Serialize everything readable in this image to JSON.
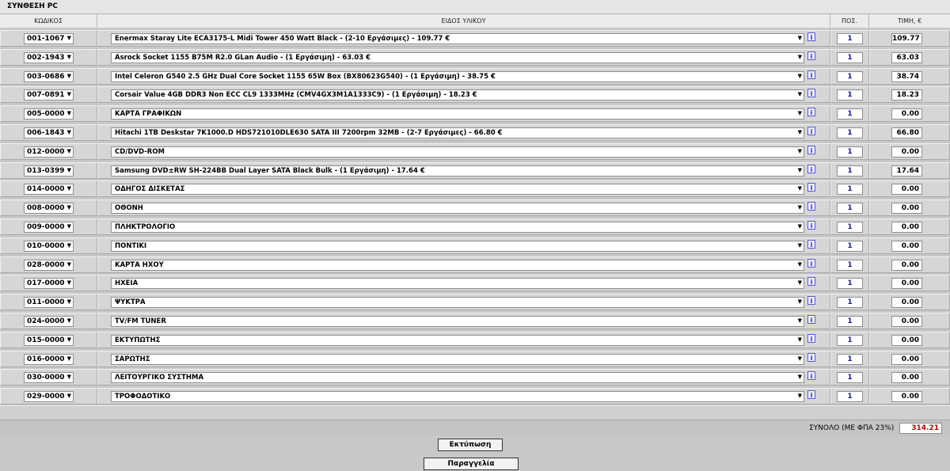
{
  "title": "ΣΥΝΘΕΣΗ PC",
  "headers": {
    "code": "ΚΩΔΙΚΟΣ",
    "item": "ΕΙΔΟΣ ΥΛΙΚΟΥ",
    "qty": "ΠΟΣ.",
    "price": "ΤΙΜΗ, €"
  },
  "rows": [
    {
      "code": "001-1067",
      "item": "Enermax Staray Lite ECA3175-L Midi Tower 450 Watt Black - (2-10 Εργάσιμες) - 109.77 €",
      "qty": "1",
      "price": "109.77"
    },
    {
      "code": "002-1943",
      "item": "Asrock Socket 1155 B75M R2.0 GLan Audio - (1 Εργάσιμη) - 63.03 €",
      "qty": "1",
      "price": "63.03"
    },
    {
      "code": "003-0686",
      "item": "Intel Celeron G540 2.5 GHz Dual Core Socket 1155 65W Box (BX80623G540) - (1 Εργάσιμη) - 38.75 €",
      "qty": "1",
      "price": "38.74"
    },
    {
      "code": "007-0891",
      "item": "Corsair Value 4GB DDR3 Non ECC CL9 1333MHz (CMV4GX3M1A1333C9) - (1 Εργάσιμη) - 18.23 €",
      "qty": "1",
      "price": "18.23"
    },
    {
      "code": "005-0000",
      "item": "ΚΑΡΤΑ ΓΡΑΦΙΚΩΝ",
      "qty": "1",
      "price": "0.00"
    },
    {
      "code": "006-1843",
      "item": "Hitachi 1TB Deskstar 7K1000.D HDS721010DLE630 SATA III 7200rpm 32MB - (2-7 Εργάσιμες) - 66.80 €",
      "qty": "1",
      "price": "66.80"
    },
    {
      "code": "012-0000",
      "item": "CD/DVD-ROM",
      "qty": "1",
      "price": "0.00"
    },
    {
      "code": "013-0399",
      "item": "Samsung DVD±RW SH-224BB Dual Layer SATA Black Bulk - (1 Εργάσιμη) - 17.64 €",
      "qty": "1",
      "price": "17.64"
    },
    {
      "code": "014-0000",
      "item": "ΟΔΗΓΟΣ ΔΙΣΚΕΤΑΣ",
      "qty": "1",
      "price": "0.00"
    },
    {
      "code": "008-0000",
      "item": "ΟΘΟΝΗ",
      "qty": "1",
      "price": "0.00"
    },
    {
      "code": "009-0000",
      "item": "ΠΛΗΚΤΡΟΛΟΓΙΟ",
      "qty": "1",
      "price": "0.00"
    },
    {
      "code": "010-0000",
      "item": "ΠΟΝΤΙΚΙ",
      "qty": "1",
      "price": "0.00"
    },
    {
      "code": "028-0000",
      "item": "ΚΑΡΤΑ ΗΧΟΥ",
      "qty": "1",
      "price": "0.00"
    },
    {
      "code": "017-0000",
      "item": "ΗΧΕΙΑ",
      "qty": "1",
      "price": "0.00"
    },
    {
      "code": "011-0000",
      "item": "ΨΥΚΤΡΑ",
      "qty": "1",
      "price": "0.00"
    },
    {
      "code": "024-0000",
      "item": "TV/FM TUNER",
      "qty": "1",
      "price": "0.00"
    },
    {
      "code": "015-0000",
      "item": "ΕΚΤΥΠΩΤΗΣ",
      "qty": "1",
      "price": "0.00"
    },
    {
      "code": "016-0000",
      "item": "ΣΑΡΩΤΗΣ",
      "qty": "1",
      "price": "0.00"
    },
    {
      "code": "030-0000",
      "item": "ΛΕΙΤΟΥΡΓΙΚΟ ΣΥΣΤΗΜΑ",
      "qty": "1",
      "price": "0.00"
    },
    {
      "code": "029-0000",
      "item": "ΤΡΟΦΟΔΟΤΙΚΟ",
      "qty": "1",
      "price": "0.00"
    }
  ],
  "info_label": "i",
  "dropdown_arrow": "▼",
  "total": {
    "label": "ΣΥΝΟΛΟ (ΜΕ ΦΠΑ 23%)",
    "value": "314.21"
  },
  "buttons": {
    "print": "Εκτύπωση",
    "order": "Παραγγελία"
  },
  "colors": {
    "total_value": "#c00000",
    "qty_text": "#1a1aa0"
  }
}
